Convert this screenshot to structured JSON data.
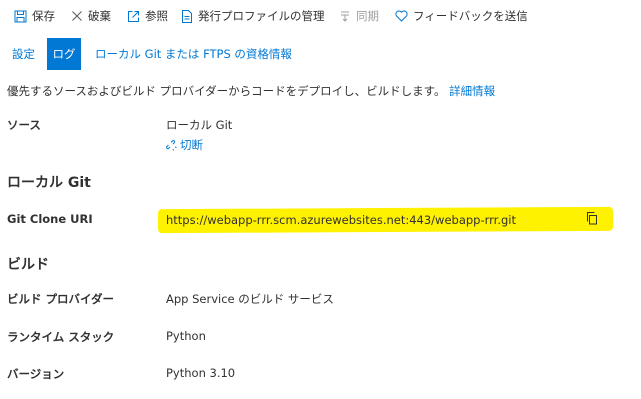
{
  "toolbar": {
    "save": "保存",
    "discard": "破棄",
    "browse": "参照",
    "manage_profile": "発行プロファイルの管理",
    "sync": "同期",
    "feedback": "フィードバックを送信"
  },
  "tabs": {
    "settings": "設定",
    "logs": "ログ",
    "credentials": "ローカル Git または FTPS の資格情報"
  },
  "description": {
    "text": "優先するソースおよびビルド プロバイダーからコードをデプロイし、ビルドします。",
    "link": "詳細情報"
  },
  "source": {
    "label": "ソース",
    "value": "ローカル Git",
    "disconnect": "切断"
  },
  "local_git": {
    "heading": "ローカル Git",
    "uri_label": "Git Clone URI",
    "uri_value": "https://webapp-rrr.scm.azurewebsites.net:443/webapp-rrr.git"
  },
  "build": {
    "heading": "ビルド",
    "provider_label": "ビルド プロバイダー",
    "provider_value": "App Service のビルド サービス",
    "stack_label": "ランタイム スタック",
    "stack_value": "Python",
    "version_label": "バージョン",
    "version_value": "Python 3.10"
  },
  "colors": {
    "accent": "#0078d4",
    "highlight": "#fff200",
    "text": "#323130",
    "disabled": "#a19f9d"
  },
  "icons": {
    "save": "save-icon",
    "discard": "close-icon",
    "browse": "external-link-icon",
    "manage_profile": "document-icon",
    "sync": "sync-icon",
    "feedback": "heart-icon",
    "disconnect": "unlink-icon",
    "copy": "copy-icon"
  }
}
